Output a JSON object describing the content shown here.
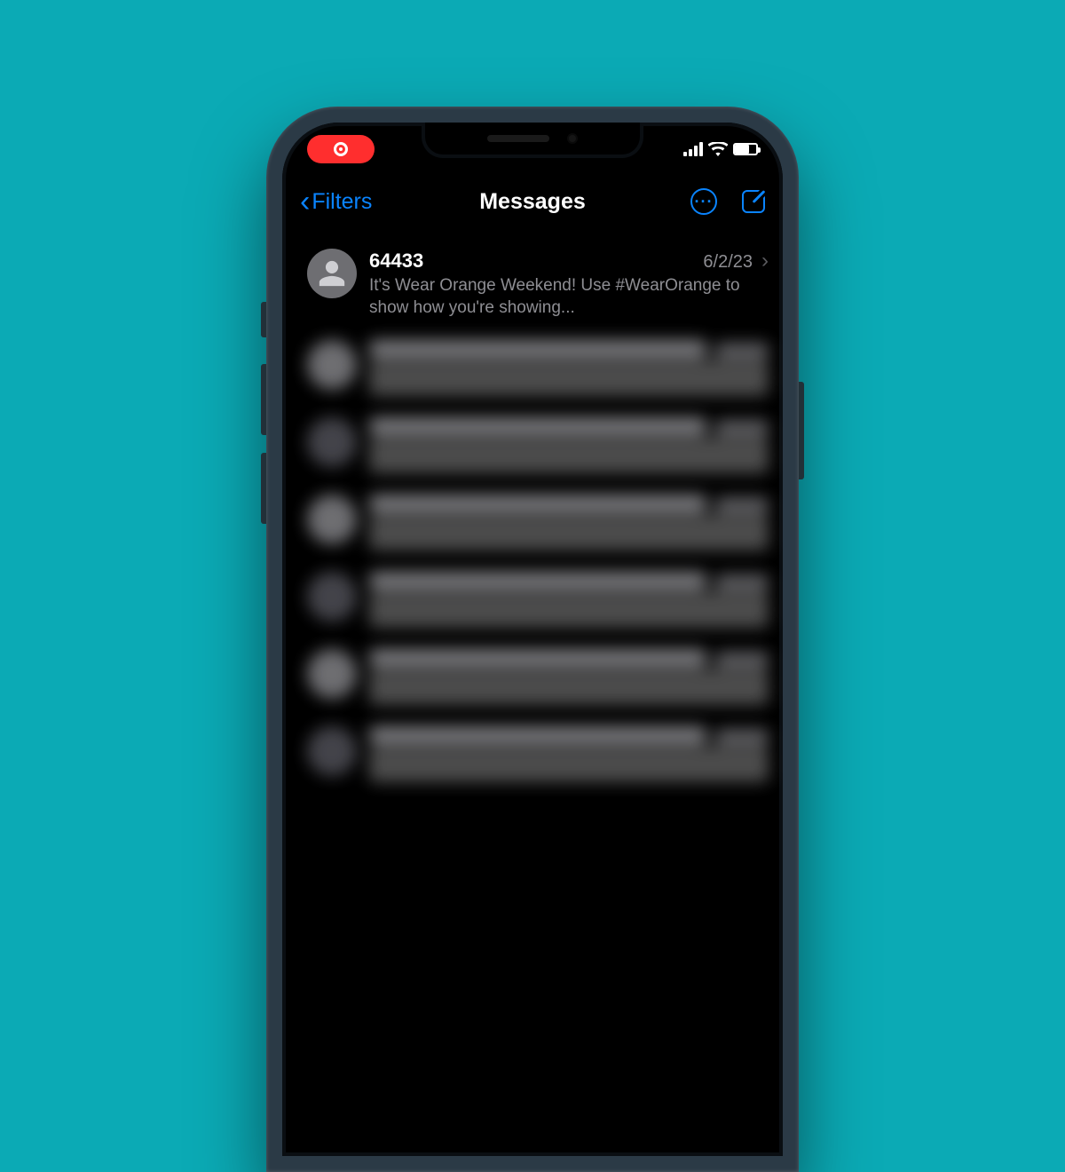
{
  "colors": {
    "background": "#0baab5",
    "accent": "#0a84ff",
    "recording": "#ff2e2e"
  },
  "status": {
    "recording": true
  },
  "nav": {
    "back_label": "Filters",
    "title": "Messages"
  },
  "conversations": [
    {
      "sender": "64433",
      "date": "6/2/23",
      "preview": "It's Wear Orange Weekend! Use #WearOrange to show how you're showing...",
      "blurred": false
    },
    {
      "sender": "",
      "date": "",
      "preview": "",
      "blurred": true
    },
    {
      "sender": "",
      "date": "",
      "preview": "",
      "blurred": true
    },
    {
      "sender": "",
      "date": "",
      "preview": "",
      "blurred": true
    },
    {
      "sender": "",
      "date": "",
      "preview": "",
      "blurred": true
    },
    {
      "sender": "",
      "date": "",
      "preview": "",
      "blurred": true
    },
    {
      "sender": "",
      "date": "",
      "preview": "",
      "blurred": true
    }
  ]
}
